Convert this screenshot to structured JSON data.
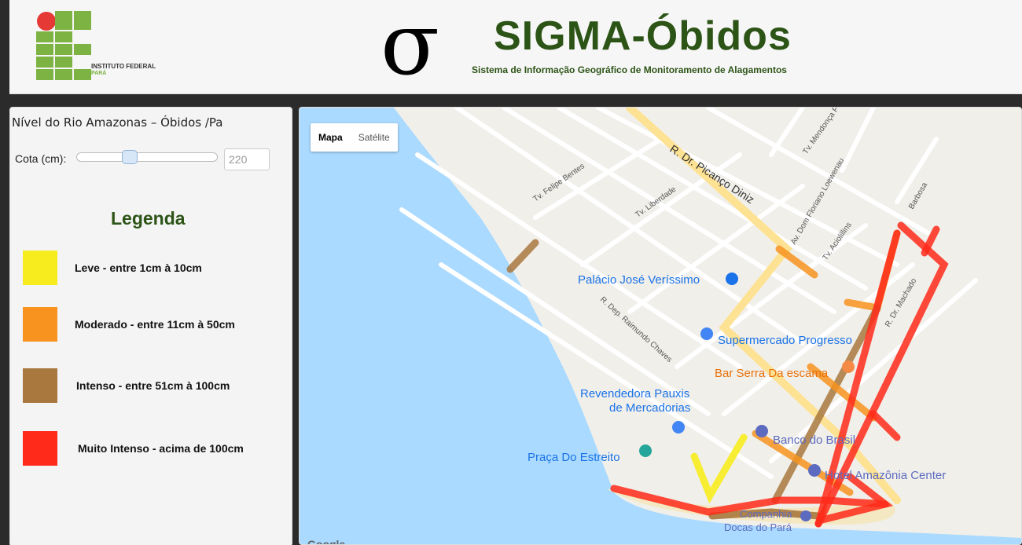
{
  "header": {
    "logo_text": "INSTITUTO FEDERAL",
    "logo_subtext": "PARÁ",
    "sigma_symbol": "σ",
    "title": "SIGMA-Óbidos",
    "subtitle": "Sistema de Informação Geográfico de Monitoramento de Alagamentos"
  },
  "panel": {
    "title": "Nível do Rio Amazonas – Óbidos /Pa",
    "cota_label": "Cota (cm):",
    "cota_value": "220",
    "cota_fraction": 0.38,
    "legend_title": "Legenda",
    "legend": [
      {
        "label": "Leve - entre 1cm à 10cm",
        "color": "#f7ec1e"
      },
      {
        "label": "Moderado - entre 11cm à 50cm",
        "color": "#f7931e"
      },
      {
        "label": "Intenso - entre 51cm à 100cm",
        "color": "#a8783e"
      },
      {
        "label": "Muito Intenso - acima de 100cm",
        "color": "#ff2a1a"
      }
    ]
  },
  "map": {
    "map_type_options": [
      "Mapa",
      "Satélite"
    ],
    "selected_map_type": "Mapa",
    "google_mark": "Google",
    "streets": [
      "R. Dr. Picanço Diniz",
      "Tv. Felipe Bentes",
      "Tv. Liberdade",
      "Av. Dom Floriano Loewenau",
      "Tv. Mendonça F",
      "Tv. Aciolillins",
      "Barbosa",
      "R. Dr. Machado",
      "R. Dep. Raimundo Chaves"
    ],
    "places": [
      "Palácio José Veríssimo",
      "Supermercado Progresso",
      "Bar Serra Da escama",
      "Revendedora Pauxis",
      "de Mercadorias",
      "Banco do Brasil",
      "Praça Do Estreito",
      "Hotel Amazônia Center",
      "Companhia",
      "Docas do Pará"
    ]
  },
  "colors": {
    "water": "#aadaff",
    "land": "#f1efea",
    "brand_green": "#2d5417"
  }
}
